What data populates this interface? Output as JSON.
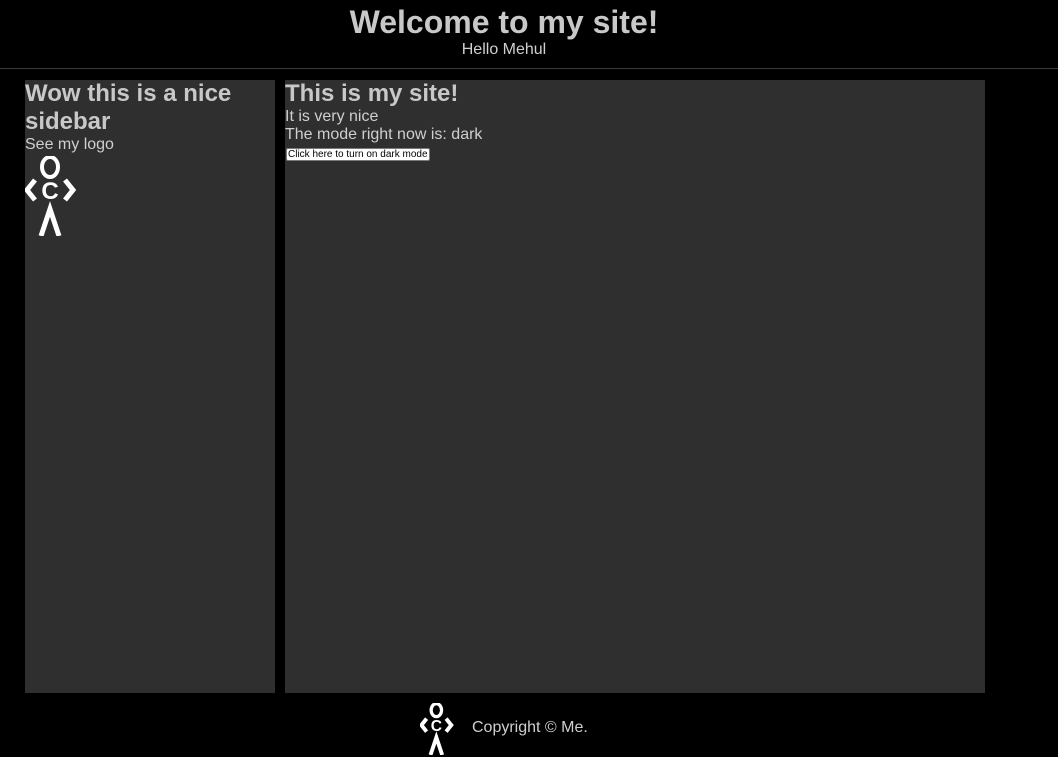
{
  "header": {
    "title": "Welcome to my site!",
    "greeting": "Hello Mehul"
  },
  "sidebar": {
    "title": "Wow this is a nice sidebar",
    "logo_caption": "See my logo",
    "logo_icon": "stick-figure-logo-icon"
  },
  "main": {
    "title": "This is my site!",
    "description": "It is very nice",
    "mode_label": "The mode right now is: ",
    "mode_value": "dark",
    "toggle_button_label": "Click here to turn on dark mode"
  },
  "footer": {
    "logo_icon": "stick-figure-logo-icon",
    "copyright": "Copyright © Me."
  },
  "colors": {
    "page_background": "#000000",
    "panel_background": "#2f2f2f",
    "heading_text": "#c8c8c8",
    "body_text": "#cfcfcf",
    "logo": "#ffffff"
  }
}
